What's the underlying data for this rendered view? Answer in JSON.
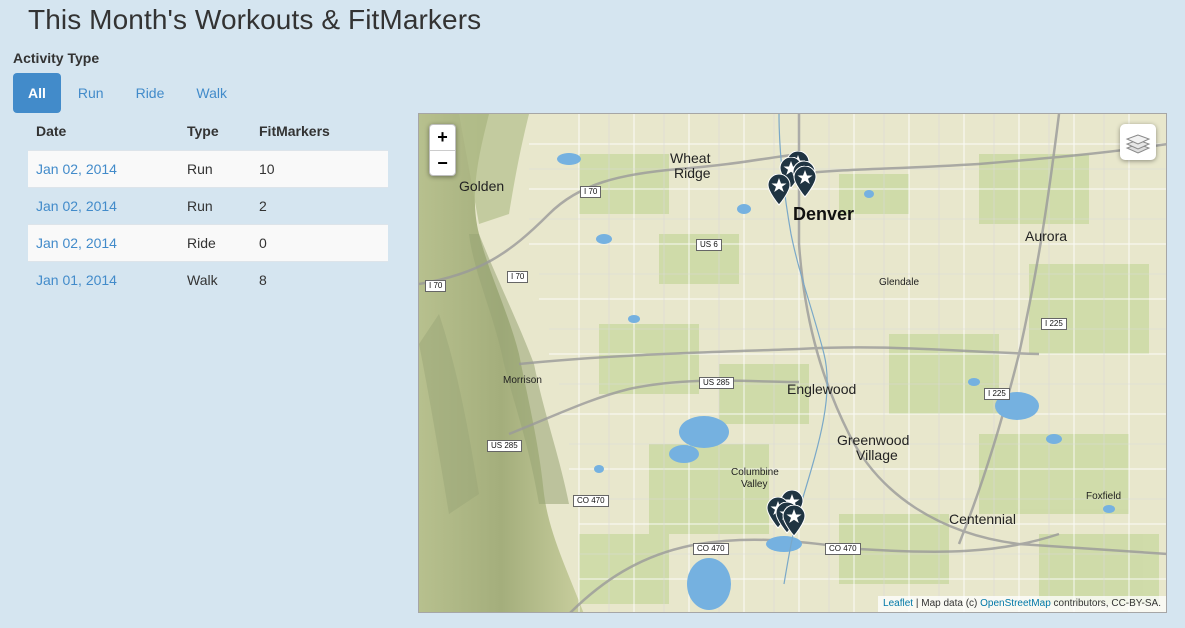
{
  "title": "This Month's Workouts & FitMarkers",
  "filter": {
    "label": "Activity Type",
    "pills": [
      "All",
      "Run",
      "Ride",
      "Walk"
    ],
    "active": "All"
  },
  "table": {
    "headers": [
      "Date",
      "Type",
      "FitMarkers"
    ],
    "rows": [
      {
        "date": "Jan 02, 2014",
        "type": "Run",
        "fitmarkers": "10"
      },
      {
        "date": "Jan 02, 2014",
        "type": "Run",
        "fitmarkers": "2"
      },
      {
        "date": "Jan 02, 2014",
        "type": "Ride",
        "fitmarkers": "0"
      },
      {
        "date": "Jan 01, 2014",
        "type": "Walk",
        "fitmarkers": "8"
      }
    ]
  },
  "map": {
    "zoom_in": "+",
    "zoom_out": "−",
    "layers_icon": "layers-icon",
    "marker_icon": "star-marker-icon",
    "places": {
      "golden": "Golden",
      "wheat_ridge_1": "Wheat",
      "wheat_ridge_2": "Ridge",
      "denver": "Denver",
      "aurora": "Aurora",
      "glendale": "Glendale",
      "morrison": "Morrison",
      "englewood": "Englewood",
      "greenwood_1": "Greenwood",
      "greenwood_2": "Village",
      "columbine_1": "Columbine",
      "columbine_2": "Valley",
      "foxfield": "Foxfield",
      "centennial": "Centennial"
    },
    "roads": {
      "i70_a": "I 70",
      "i70_b": "I 70",
      "i70_c": "I 70",
      "us6": "US 6",
      "us285_a": "US 285",
      "us285_b": "US 285",
      "i225_a": "I 225",
      "i225_b": "I 225",
      "co470_a": "CO 470",
      "co470_b": "CO 470",
      "co470_c": "CO 470"
    },
    "attribution": {
      "leaflet": "Leaflet",
      "sep": " | Map data (c) ",
      "osm": "OpenStreetMap",
      "rest": " contributors, CC-BY-SA."
    }
  },
  "colors": {
    "accent": "#428bca",
    "background": "#d5e5f0",
    "marker": "#1f3442",
    "water": "#75b1e0"
  }
}
